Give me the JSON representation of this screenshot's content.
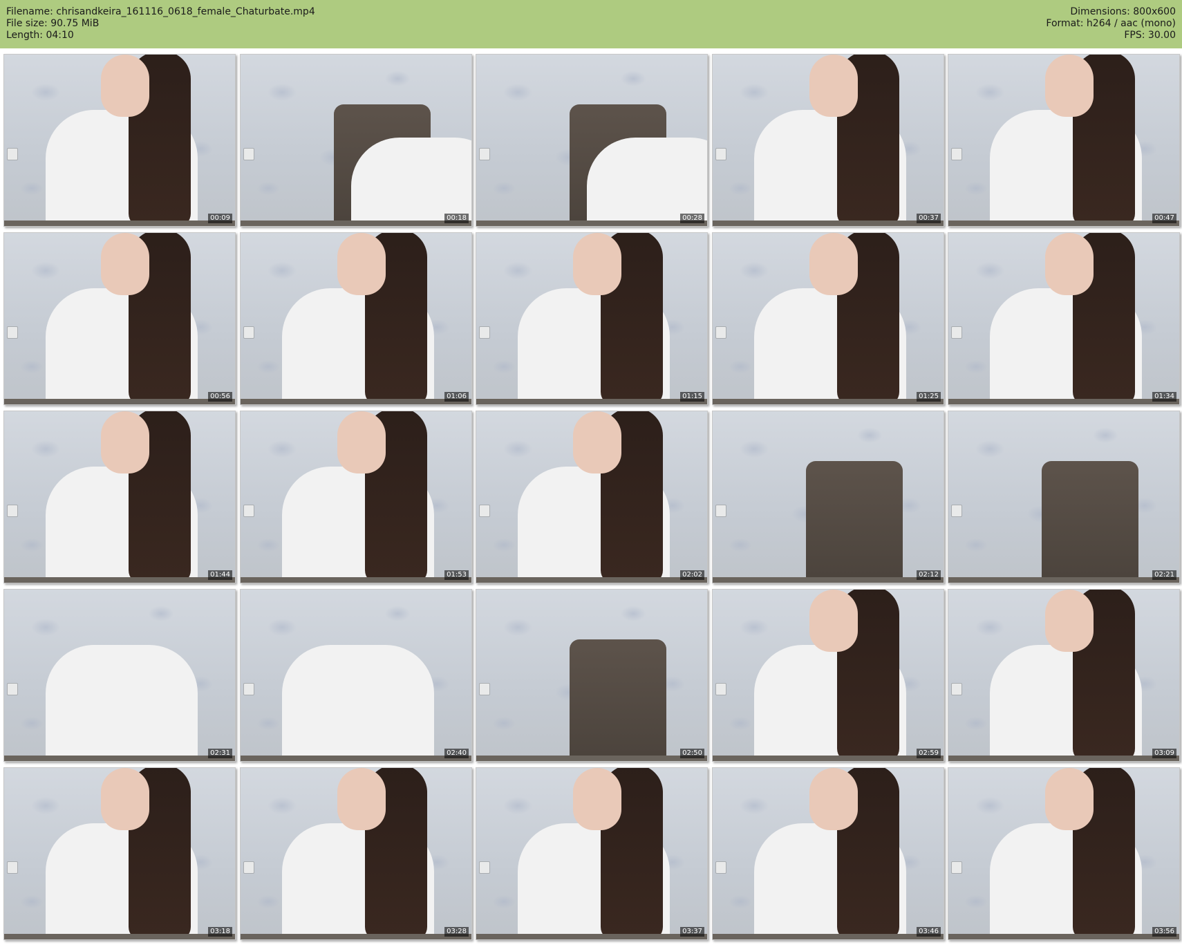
{
  "header": {
    "filename": "Filename: chrisandkeira_161116_0618_female_Chaturbate.mp4",
    "filesize": "File size: 90.75 MiB",
    "length": "Length: 04:10",
    "dimensions": "Dimensions: 800x600",
    "format": "Format: h264 / aac (mono)",
    "fps": "FPS: 30.00"
  },
  "colors": {
    "header_bg": "#aecb80",
    "page_bg": "#ffffff"
  },
  "thumbnails": [
    {
      "time": "00:09",
      "scene": "person"
    },
    {
      "time": "00:18",
      "scene": "chair-motion"
    },
    {
      "time": "00:28",
      "scene": "chair-motion"
    },
    {
      "time": "00:37",
      "scene": "person"
    },
    {
      "time": "00:47",
      "scene": "person"
    },
    {
      "time": "00:56",
      "scene": "person"
    },
    {
      "time": "01:06",
      "scene": "person"
    },
    {
      "time": "01:15",
      "scene": "person"
    },
    {
      "time": "01:25",
      "scene": "person"
    },
    {
      "time": "01:34",
      "scene": "person"
    },
    {
      "time": "01:44",
      "scene": "person"
    },
    {
      "time": "01:53",
      "scene": "person"
    },
    {
      "time": "02:02",
      "scene": "person"
    },
    {
      "time": "02:12",
      "scene": "chair"
    },
    {
      "time": "02:21",
      "scene": "chair"
    },
    {
      "time": "02:31",
      "scene": "motion"
    },
    {
      "time": "02:40",
      "scene": "motion"
    },
    {
      "time": "02:50",
      "scene": "chair"
    },
    {
      "time": "02:59",
      "scene": "person"
    },
    {
      "time": "03:09",
      "scene": "person"
    },
    {
      "time": "03:18",
      "scene": "person"
    },
    {
      "time": "03:28",
      "scene": "person"
    },
    {
      "time": "03:37",
      "scene": "person"
    },
    {
      "time": "03:46",
      "scene": "person"
    },
    {
      "time": "03:56",
      "scene": "person"
    }
  ]
}
